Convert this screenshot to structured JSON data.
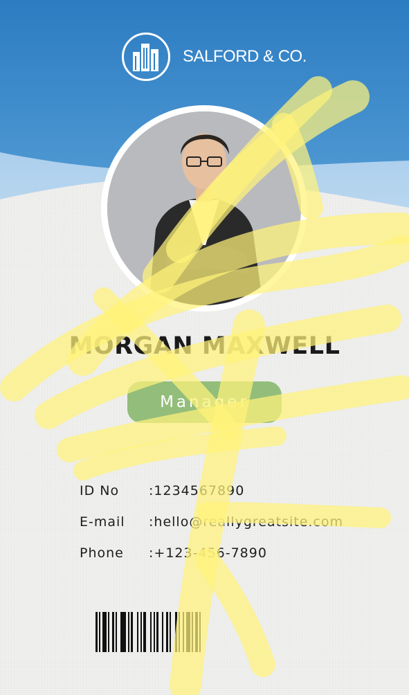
{
  "company": {
    "name": "SALFORD & CO.",
    "logo_icon": "buildings-icon"
  },
  "employee": {
    "name": "MORGAN MAXWELL",
    "role": "Manager",
    "photo_icon": "person-portrait"
  },
  "details": [
    {
      "label": "ID No",
      "value": ":1234567890"
    },
    {
      "label": "E-mail",
      "value": ":hello@reallygreatsite.com"
    },
    {
      "label": "Phone",
      "value": ":+123-456-7890"
    }
  ],
  "colors": {
    "header_blue": "#2f7fc1",
    "pill_green": "#93bd7a",
    "highlighter": "#fff27a",
    "name_text": "#1a1a1a"
  },
  "barcode": {
    "icon": "barcode-icon"
  }
}
